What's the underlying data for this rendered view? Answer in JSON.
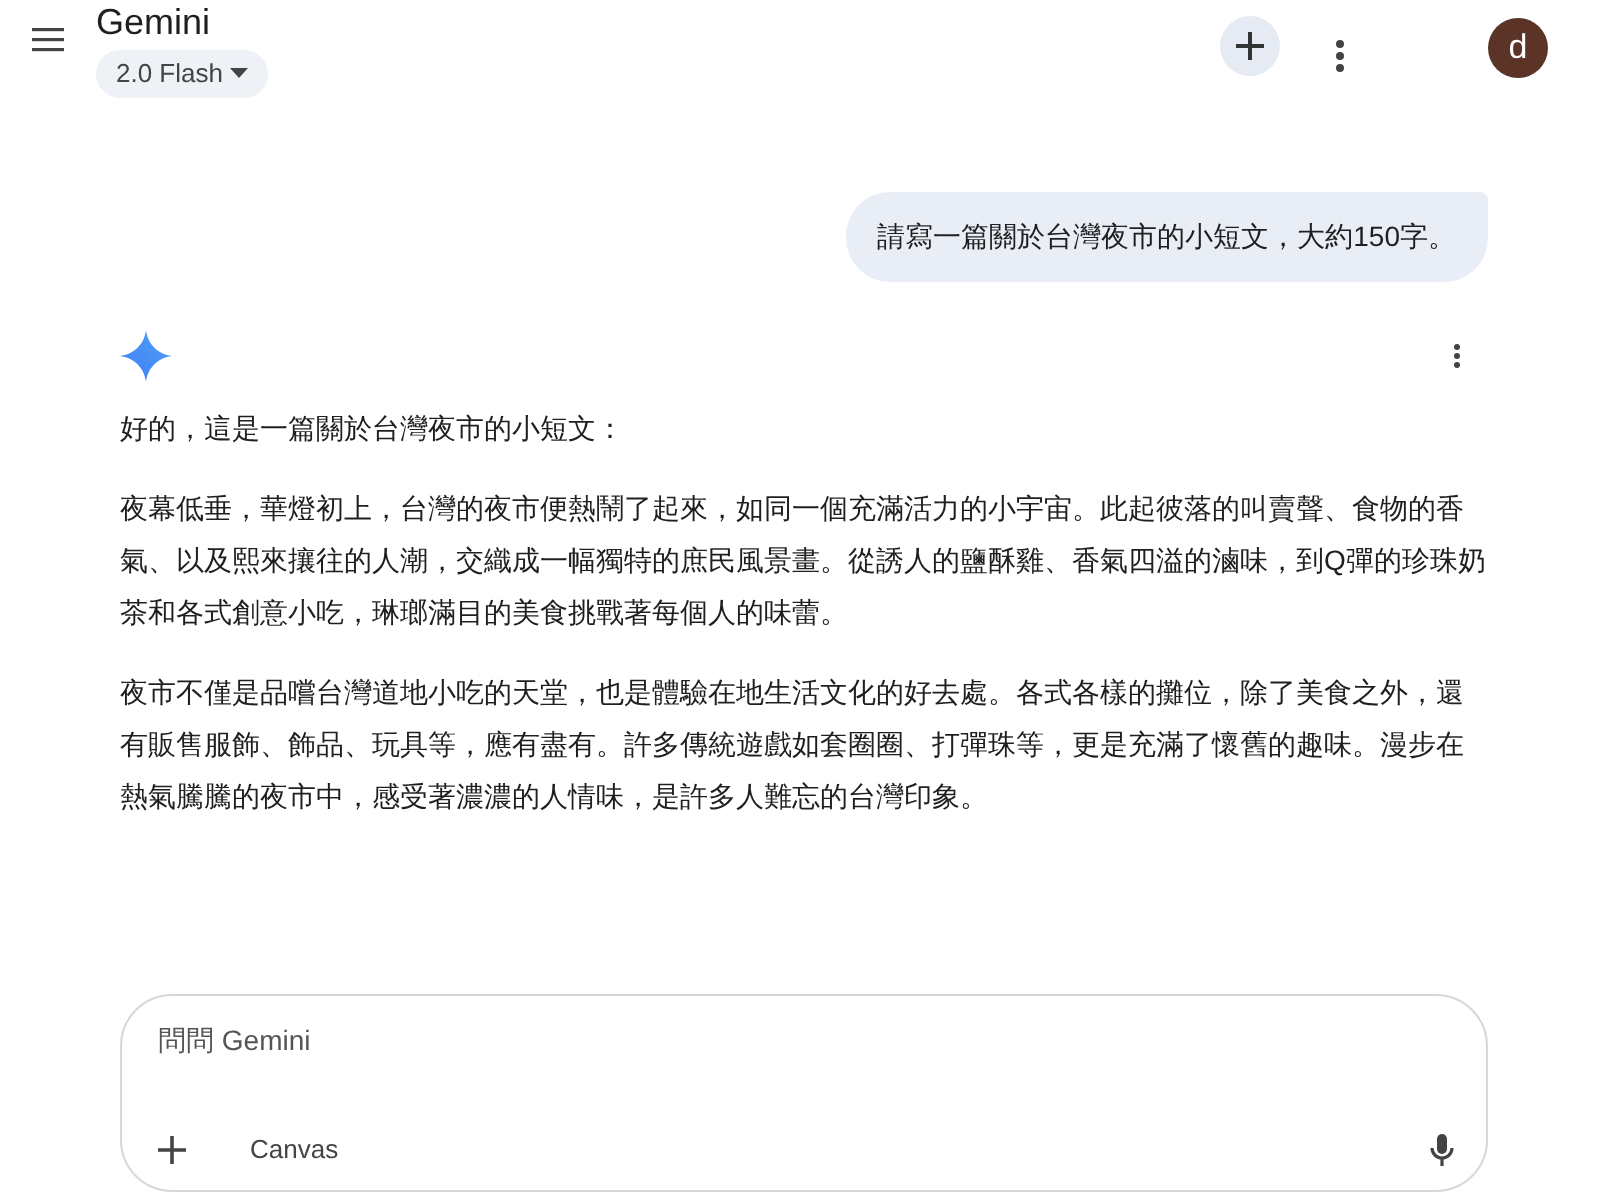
{
  "header": {
    "title": "Gemini",
    "model": "2.0 Flash",
    "avatar": "d"
  },
  "user_message": "請寫一篇關於台灣夜市的小短文，大約150字。",
  "response": {
    "paragraphs": [
      "好的，這是一篇關於台灣夜市的小短文：",
      "夜幕低垂，華燈初上，台灣的夜市便熱鬧了起來，如同一個充滿活力的小宇宙。此起彼落的叫賣聲、食物的香氣、以及熙來攘往的人潮，交織成一幅獨特的庶民風景畫。從誘人的鹽酥雞、香氣四溢的滷味，到Q彈的珍珠奶茶和各式創意小吃，琳瑯滿目的美食挑戰著每個人的味蕾。",
      "夜市不僅是品嚐台灣道地小吃的天堂，也是體驗在地生活文化的好去處。各式各樣的攤位，除了美食之外，還有販售服飾、飾品、玩具等，應有盡有。許多傳統遊戲如套圈圈、打彈珠等，更是充滿了懷舊的趣味。漫步在熱氣騰騰的夜市中，感受著濃濃的人情味，是許多人難忘的台灣印象。"
    ]
  },
  "composer": {
    "placeholder": "問問 Gemini",
    "canvas_label": "Canvas"
  }
}
